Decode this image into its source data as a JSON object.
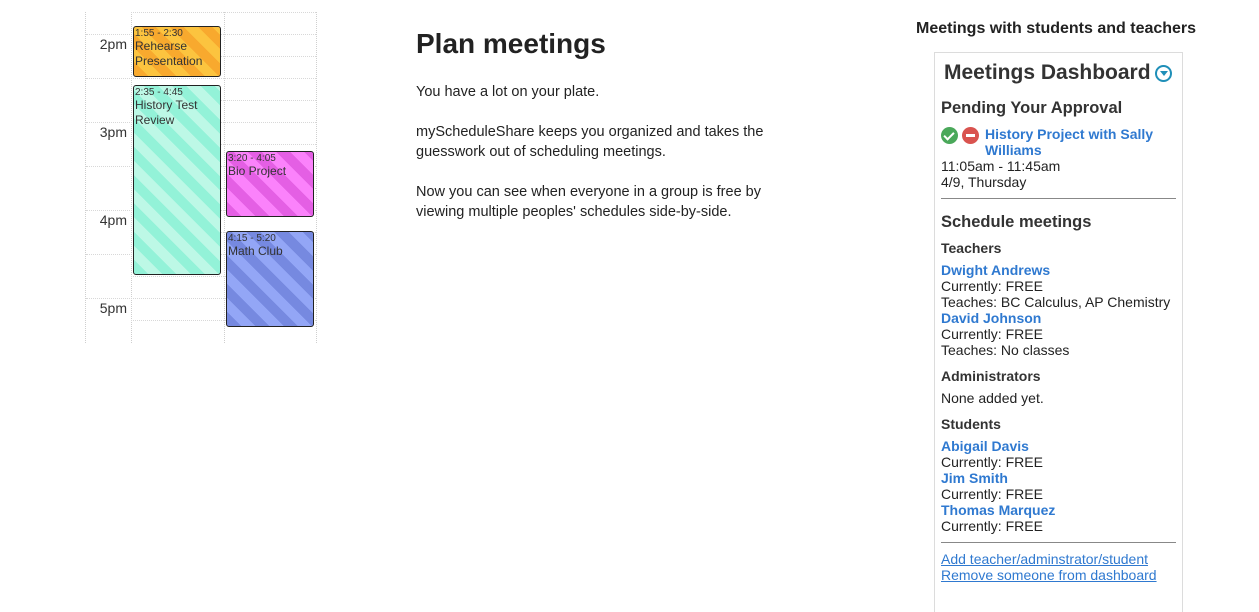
{
  "calendar": {
    "times": [
      "2pm",
      "3pm",
      "4pm",
      "5pm"
    ],
    "events": [
      {
        "time": "1:55 - 2:30",
        "title": "Rehearse Presentation",
        "color": "#f8a92e"
      },
      {
        "time": "2:35 - 4:45",
        "title": "History Test Review",
        "color": "#93f2d8"
      },
      {
        "time": "3:20 - 4:05",
        "title": "Bio Project",
        "color": "#e45fe4"
      },
      {
        "time": "4:15 - 5:20",
        "title": "Math Club",
        "color": "#7689e0"
      }
    ]
  },
  "hero": {
    "title": "Plan meetings",
    "p1": "You have a lot on your plate.",
    "p2": "myScheduleShare keeps you organized and takes the guesswork out of scheduling meetings.",
    "p3": "Now you can see when everyone in a group is free by viewing multiple peoples' schedules side-by-side."
  },
  "sidebar": {
    "title": "Meetings with students and teachers",
    "dashboard_title": "Meetings Dashboard",
    "pending_heading": "Pending Your Approval",
    "pending": {
      "name": "History Project with Sally Williams",
      "time": "11:05am - 11:45am",
      "date": "4/9, Thursday"
    },
    "schedule_heading": "Schedule meetings",
    "teachers_heading": "Teachers",
    "teachers": [
      {
        "name": "Dwight Andrews",
        "status": "Currently: FREE",
        "teaches": "Teaches: BC Calculus, AP Chemistry"
      },
      {
        "name": "David Johnson",
        "status": "Currently: FREE",
        "teaches": "Teaches: No classes"
      }
    ],
    "admins_heading": "Administrators",
    "admins_none": "None added yet.",
    "students_heading": "Students",
    "students": [
      {
        "name": "Abigail Davis",
        "status": "Currently: FREE"
      },
      {
        "name": "Jim Smith",
        "status": "Currently: FREE"
      },
      {
        "name": "Thomas Marquez",
        "status": "Currently: FREE"
      }
    ],
    "add_link": "Add teacher/adminstrator/student",
    "remove_link": "Remove someone from dashboard",
    "link_color": "#2f79d0"
  }
}
